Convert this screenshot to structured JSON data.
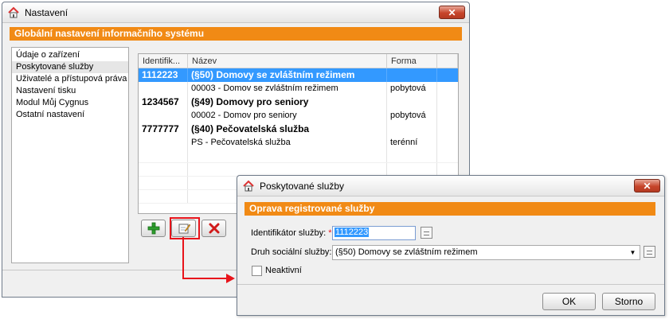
{
  "colors": {
    "accent": "#f18a15",
    "selection": "#3399ff",
    "highlight_red": "#e8141b",
    "add_green": "#2e9e2e",
    "delete_red": "#d11a1a"
  },
  "main_window": {
    "title": "Nastavení",
    "app_icon": "house-icon",
    "close_icon": "close-icon",
    "header": "Globální nastavení informačního systému",
    "nav_items": [
      {
        "label": "Údaje o zařízení"
      },
      {
        "label": "Poskytované služby",
        "selected": true
      },
      {
        "label": "Uživatelé a přístupová práva"
      },
      {
        "label": "Nastavení tisku"
      },
      {
        "label": "Modul Můj Cygnus"
      },
      {
        "label": "Ostatní nastavení"
      }
    ],
    "grid": {
      "columns": [
        "Identifik...",
        "Název",
        "Forma"
      ],
      "rows": [
        {
          "id": "1112223",
          "name": "(§50) Domovy se zvláštním režimem",
          "form": "",
          "bold": true,
          "selected": true
        },
        {
          "id": "",
          "name": "00003 - Domov se zvláštním režimem",
          "form": "pobytová"
        },
        {
          "id": "1234567",
          "name": "(§49) Domovy pro seniory",
          "form": "",
          "bold": true
        },
        {
          "id": "",
          "name": "00002 - Domov pro seniory",
          "form": "pobytová"
        },
        {
          "id": "7777777",
          "name": "(§40) Pečovatelská služba",
          "form": "",
          "bold": true
        },
        {
          "id": "",
          "name": "PS - Pečovatelská služba",
          "form": "terénní"
        }
      ]
    },
    "toolbar": {
      "add_icon": "plus-icon",
      "edit_icon": "edit-icon",
      "delete_icon": "delete-icon"
    }
  },
  "dialog": {
    "title": "Poskytované služby",
    "header": "Oprava registrované služby",
    "id_label": "Identifikátor služby:",
    "required_mark": "*",
    "id_value": "1112223",
    "type_label": "Druh sociální služby:",
    "type_value": "(§50) Domovy se zvláštním režimem",
    "inactive_label": "Neaktivní",
    "inactive_checked": false,
    "ok_label": "OK",
    "cancel_label": "Storno"
  }
}
